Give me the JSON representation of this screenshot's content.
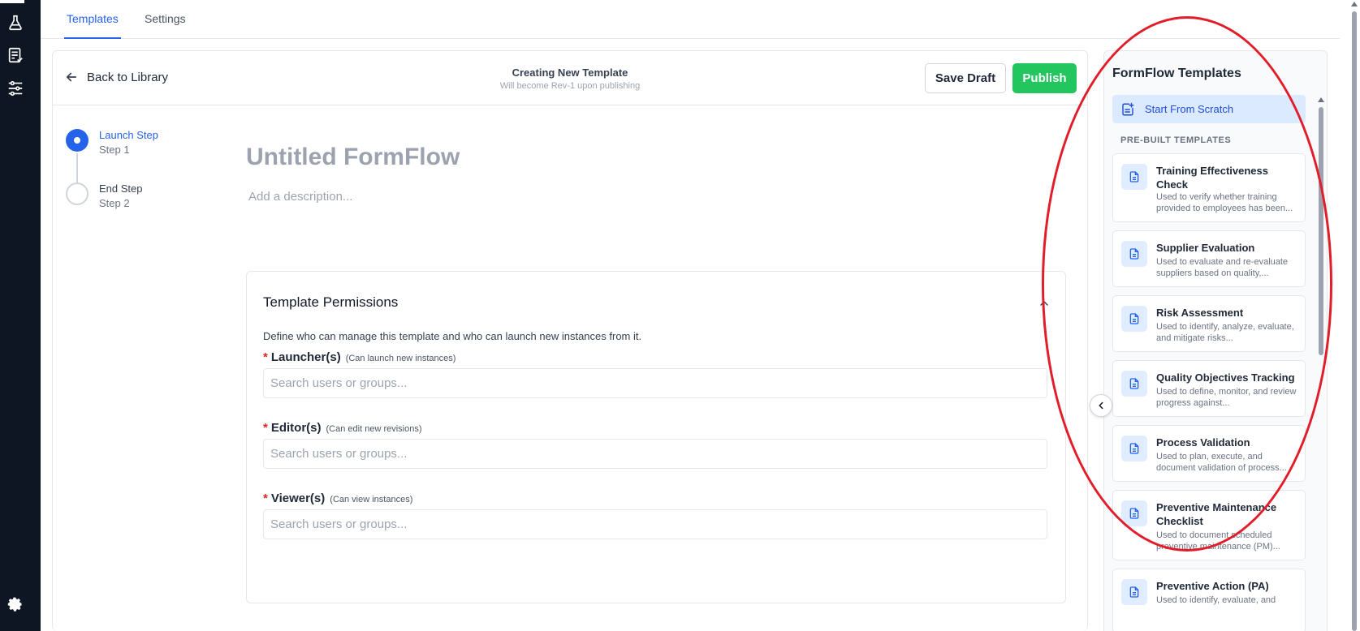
{
  "top_tabs": [
    {
      "label": "Templates",
      "active": true
    },
    {
      "label": "Settings",
      "active": false
    }
  ],
  "editor": {
    "back_label": "Back to Library",
    "header_title": "Creating New Template",
    "header_subtitle": "Will become Rev-1 upon publishing",
    "save_draft_label": "Save Draft",
    "publish_label": "Publish",
    "steps": [
      {
        "name": "Launch Step",
        "sub": "Step 1",
        "active": true
      },
      {
        "name": "End Step",
        "sub": "Step 2",
        "active": false
      }
    ],
    "form_title": "Untitled FormFlow",
    "description_placeholder": "Add a description..."
  },
  "permissions": {
    "title": "Template Permissions",
    "intro": "Define who can manage this template and who can launch new instances from it.",
    "fields": [
      {
        "label": "Launcher(s)",
        "hint": "(Can launch new instances)",
        "placeholder": "Search users or groups..."
      },
      {
        "label": "Editor(s)",
        "hint": "(Can edit new revisions)",
        "placeholder": "Search users or groups..."
      },
      {
        "label": "Viewer(s)",
        "hint": "(Can view instances)",
        "placeholder": "Search users or groups..."
      }
    ]
  },
  "panel": {
    "title": "FormFlow Templates",
    "scratch_label": "Start From Scratch",
    "prebuilt_heading": "PRE-BUILT TEMPLATES",
    "templates": [
      {
        "name": "Training Effectiveness Check",
        "desc": "Used to verify whether training provided to employees has been..."
      },
      {
        "name": "Supplier Evaluation",
        "desc": "Used to evaluate and re-evaluate suppliers based on quality,..."
      },
      {
        "name": "Risk Assessment",
        "desc": "Used to identify, analyze, evaluate, and mitigate risks..."
      },
      {
        "name": "Quality Objectives Tracking",
        "desc": "Used to define, monitor, and review progress against..."
      },
      {
        "name": "Process Validation",
        "desc": "Used to plan, execute, and document validation of process..."
      },
      {
        "name": "Preventive Maintenance Checklist",
        "desc": "Used to document scheduled preventive maintenance (PM)..."
      },
      {
        "name": "Preventive Action (PA)",
        "desc": "Used to identify, evaluate, and"
      }
    ]
  },
  "colors": {
    "accent": "#2563eb",
    "publish": "#22c55e",
    "required": "#dc2626",
    "annotation": "#e11d2a",
    "rail": "#0f1623"
  },
  "icons": {
    "rail": [
      "flask-icon",
      "checklist-document-icon",
      "workflow-sliders-icon",
      "settings-gear-icon"
    ],
    "back": "arrow-left-icon",
    "scratch": "add-document-icon",
    "template": "document-icon",
    "collapse": "chevron-left-icon",
    "section_toggle": "chevron-up-icon"
  }
}
